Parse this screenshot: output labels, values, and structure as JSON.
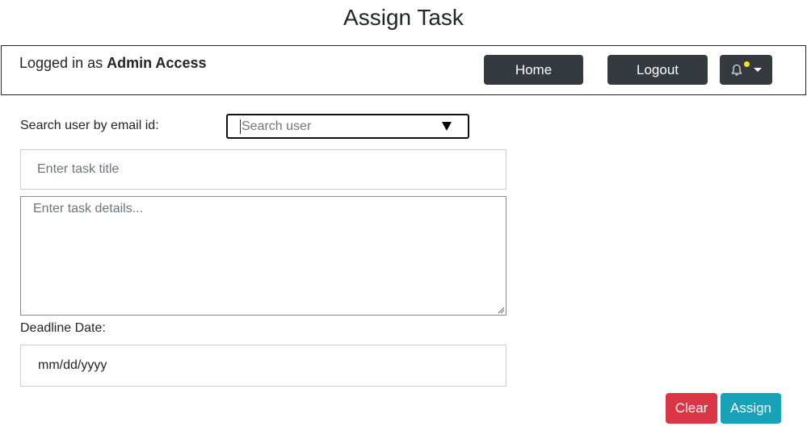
{
  "page": {
    "title": "Assign Task"
  },
  "navbar": {
    "logged_prefix": "Logged in as ",
    "user_name": "Admin Access",
    "home_label": "Home",
    "logout_label": "Logout",
    "notification_icon": "bell-icon"
  },
  "form": {
    "search_label": "Search user by email id:",
    "search_placeholder": "Search user",
    "task_title_placeholder": "Enter task title",
    "task_details_placeholder": "Enter task details...",
    "deadline_label": "Deadline Date:",
    "deadline_value": "mm/dd/yyyy"
  },
  "actions": {
    "clear_label": "Clear",
    "assign_label": "Assign"
  },
  "colors": {
    "nav_button": "#343a40",
    "clear": "#dc3545",
    "assign": "#17a2b8",
    "notification_dot": "#ffe600"
  }
}
